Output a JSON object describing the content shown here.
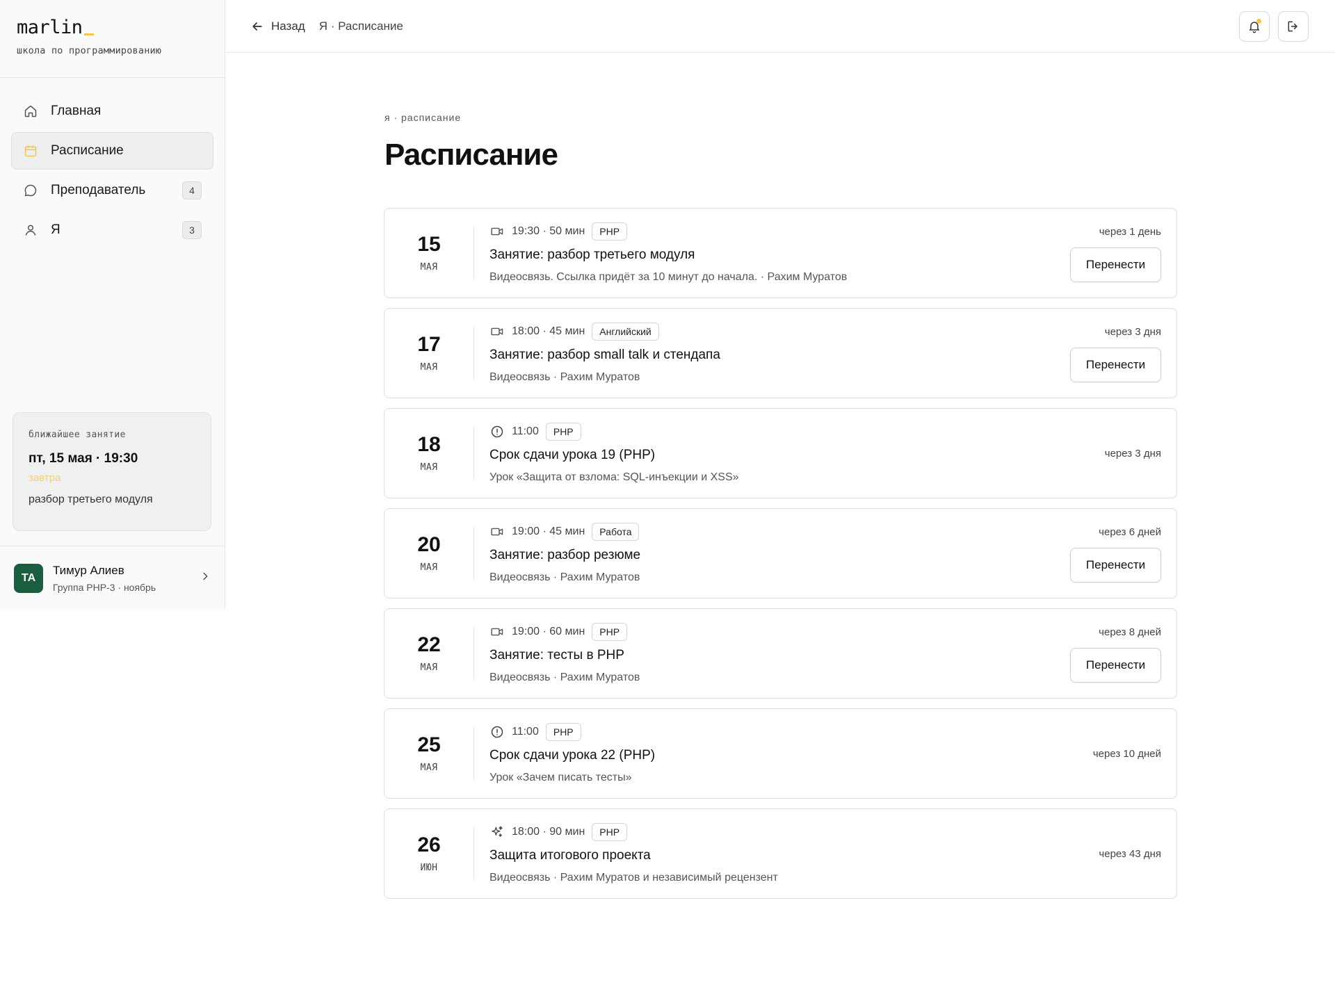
{
  "brand": {
    "logo": "marlin",
    "tagline": "школа по программированию"
  },
  "sidebar": {
    "items": [
      {
        "label": "Главная",
        "icon": "home-icon",
        "badge": ""
      },
      {
        "label": "Расписание",
        "icon": "calendar-icon",
        "badge": "",
        "active": true
      },
      {
        "label": "Преподаватель",
        "icon": "chat-icon",
        "badge": "4"
      },
      {
        "label": "Я",
        "icon": "user-icon",
        "badge": "3"
      }
    ],
    "next_lesson": {
      "caption": "ближайшее занятие",
      "when": "пт, 15 мая · 19:30",
      "relative": "завтра",
      "title": "разбор третьего модуля"
    },
    "user": {
      "initials": "ТА",
      "name": "Тимур Алиев",
      "group": "Группа PHP-3 · ноябрь"
    }
  },
  "topbar": {
    "back_label": "Назад",
    "breadcrumb": "Я · Расписание"
  },
  "main": {
    "breadcrumb": "я  ·  расписание",
    "title": "Расписание"
  },
  "events": [
    {
      "day": "15",
      "month": "МАЯ",
      "icon": "video-icon",
      "meta": "19:30 · 50 мин",
      "tag": "PHP",
      "title": "Занятие: разбор третьего модуля",
      "subtitle": "Видеосвязь. Ссылка придёт за 10 минут до начала. · Рахим Муратов",
      "relative": "через 1 день",
      "action": "Перенести"
    },
    {
      "day": "17",
      "month": "МАЯ",
      "icon": "video-icon",
      "meta": "18:00 · 45 мин",
      "tag": "Английский",
      "title": "Занятие: разбор small talk и стендапа",
      "subtitle": "Видеосвязь · Рахим Муратов",
      "relative": "через 3 дня",
      "action": "Перенести"
    },
    {
      "day": "18",
      "month": "МАЯ",
      "icon": "deadline-icon",
      "meta": "11:00",
      "tag": "PHP",
      "title": "Срок сдачи урока 19 (PHP)",
      "subtitle": "Урок «Защита от взлома: SQL-инъекции и XSS»",
      "relative": "через 3 дня",
      "action": ""
    },
    {
      "day": "20",
      "month": "МАЯ",
      "icon": "video-icon",
      "meta": "19:00 · 45 мин",
      "tag": "Работа",
      "title": "Занятие: разбор резюме",
      "subtitle": "Видеосвязь · Рахим Муратов",
      "relative": "через 6 дней",
      "action": "Перенести"
    },
    {
      "day": "22",
      "month": "МАЯ",
      "icon": "video-icon",
      "meta": "19:00 · 60 мин",
      "tag": "PHP",
      "title": "Занятие: тесты в PHP",
      "subtitle": "Видеосвязь · Рахим Муратов",
      "relative": "через 8 дней",
      "action": "Перенести"
    },
    {
      "day": "25",
      "month": "МАЯ",
      "icon": "deadline-icon",
      "meta": "11:00",
      "tag": "PHP",
      "title": "Срок сдачи урока 22 (PHP)",
      "subtitle": "Урок «Зачем писать тесты»",
      "relative": "через 10 дней",
      "action": ""
    },
    {
      "day": "26",
      "month": "ИЮН",
      "icon": "sparkle-icon",
      "meta": "18:00 · 90 мин",
      "tag": "PHP",
      "title": "Защита итогового проекта",
      "subtitle": "Видеосвязь · Рахим Муратов и независимый рецензент",
      "relative": "через 43 дня",
      "action": ""
    }
  ],
  "colors": {
    "accent": "#f3c54b",
    "avatar": "#1b5e3f"
  }
}
